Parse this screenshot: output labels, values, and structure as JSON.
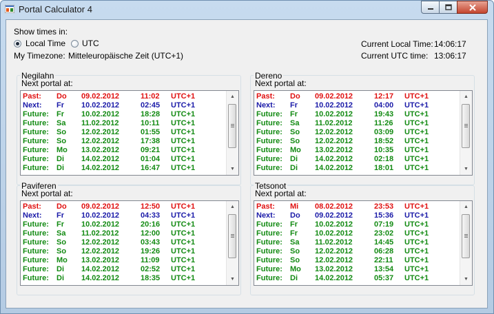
{
  "window": {
    "title": "Portal Calculator 4"
  },
  "settings": {
    "show_times_label": "Show times in:",
    "local_time_label": "Local Time",
    "utc_label": "UTC",
    "selected": "Local Time",
    "my_timezone_label": "My Timezone:",
    "my_timezone_value": "Mitteleuropäische Zeit (UTC+1)"
  },
  "clock": {
    "current_local_label": "Current Local Time:",
    "current_local_value": "14:06:17",
    "current_utc_label": "Current UTC time:",
    "current_utc_value": "13:06:17"
  },
  "colors": {
    "past": "#e01010",
    "next": "#1a1aa8",
    "future": "#128a12"
  },
  "portals": [
    {
      "name": "Negilahn",
      "subtitle": "Next portal at:",
      "rows": [
        {
          "type": "Past:",
          "day": "Do",
          "date": "09.02.2012",
          "time": "11:02",
          "tz": "UTC+1"
        },
        {
          "type": "Next:",
          "day": "Fr",
          "date": "10.02.2012",
          "time": "02:45",
          "tz": "UTC+1"
        },
        {
          "type": "Future:",
          "day": "Fr",
          "date": "10.02.2012",
          "time": "18:28",
          "tz": "UTC+1"
        },
        {
          "type": "Future:",
          "day": "Sa",
          "date": "11.02.2012",
          "time": "10:11",
          "tz": "UTC+1"
        },
        {
          "type": "Future:",
          "day": "So",
          "date": "12.02.2012",
          "time": "01:55",
          "tz": "UTC+1"
        },
        {
          "type": "Future:",
          "day": "So",
          "date": "12.02.2012",
          "time": "17:38",
          "tz": "UTC+1"
        },
        {
          "type": "Future:",
          "day": "Mo",
          "date": "13.02.2012",
          "time": "09:21",
          "tz": "UTC+1"
        },
        {
          "type": "Future:",
          "day": "Di",
          "date": "14.02.2012",
          "time": "01:04",
          "tz": "UTC+1"
        },
        {
          "type": "Future:",
          "day": "Di",
          "date": "14.02.2012",
          "time": "16:47",
          "tz": "UTC+1"
        }
      ]
    },
    {
      "name": "Dereno",
      "subtitle": "Next portal at:",
      "rows": [
        {
          "type": "Past:",
          "day": "Do",
          "date": "09.02.2012",
          "time": "12:17",
          "tz": "UTC+1"
        },
        {
          "type": "Next:",
          "day": "Fr",
          "date": "10.02.2012",
          "time": "04:00",
          "tz": "UTC+1"
        },
        {
          "type": "Future:",
          "day": "Fr",
          "date": "10.02.2012",
          "time": "19:43",
          "tz": "UTC+1"
        },
        {
          "type": "Future:",
          "day": "Sa",
          "date": "11.02.2012",
          "time": "11:26",
          "tz": "UTC+1"
        },
        {
          "type": "Future:",
          "day": "So",
          "date": "12.02.2012",
          "time": "03:09",
          "tz": "UTC+1"
        },
        {
          "type": "Future:",
          "day": "So",
          "date": "12.02.2012",
          "time": "18:52",
          "tz": "UTC+1"
        },
        {
          "type": "Future:",
          "day": "Mo",
          "date": "13.02.2012",
          "time": "10:35",
          "tz": "UTC+1"
        },
        {
          "type": "Future:",
          "day": "Di",
          "date": "14.02.2012",
          "time": "02:18",
          "tz": "UTC+1"
        },
        {
          "type": "Future:",
          "day": "Di",
          "date": "14.02.2012",
          "time": "18:01",
          "tz": "UTC+1"
        }
      ]
    },
    {
      "name": "Paviferen",
      "subtitle": "Next portal at:",
      "rows": [
        {
          "type": "Past:",
          "day": "Do",
          "date": "09.02.2012",
          "time": "12:50",
          "tz": "UTC+1"
        },
        {
          "type": "Next:",
          "day": "Fr",
          "date": "10.02.2012",
          "time": "04:33",
          "tz": "UTC+1"
        },
        {
          "type": "Future:",
          "day": "Fr",
          "date": "10.02.2012",
          "time": "20:16",
          "tz": "UTC+1"
        },
        {
          "type": "Future:",
          "day": "Sa",
          "date": "11.02.2012",
          "time": "12:00",
          "tz": "UTC+1"
        },
        {
          "type": "Future:",
          "day": "So",
          "date": "12.02.2012",
          "time": "03:43",
          "tz": "UTC+1"
        },
        {
          "type": "Future:",
          "day": "So",
          "date": "12.02.2012",
          "time": "19:26",
          "tz": "UTC+1"
        },
        {
          "type": "Future:",
          "day": "Mo",
          "date": "13.02.2012",
          "time": "11:09",
          "tz": "UTC+1"
        },
        {
          "type": "Future:",
          "day": "Di",
          "date": "14.02.2012",
          "time": "02:52",
          "tz": "UTC+1"
        },
        {
          "type": "Future:",
          "day": "Di",
          "date": "14.02.2012",
          "time": "18:35",
          "tz": "UTC+1"
        }
      ]
    },
    {
      "name": "Tetsonot",
      "subtitle": "Next portal at:",
      "rows": [
        {
          "type": "Past:",
          "day": "Mi",
          "date": "08.02.2012",
          "time": "23:53",
          "tz": "UTC+1"
        },
        {
          "type": "Next:",
          "day": "Do",
          "date": "09.02.2012",
          "time": "15:36",
          "tz": "UTC+1"
        },
        {
          "type": "Future:",
          "day": "Fr",
          "date": "10.02.2012",
          "time": "07:19",
          "tz": "UTC+1"
        },
        {
          "type": "Future:",
          "day": "Fr",
          "date": "10.02.2012",
          "time": "23:02",
          "tz": "UTC+1"
        },
        {
          "type": "Future:",
          "day": "Sa",
          "date": "11.02.2012",
          "time": "14:45",
          "tz": "UTC+1"
        },
        {
          "type": "Future:",
          "day": "So",
          "date": "12.02.2012",
          "time": "06:28",
          "tz": "UTC+1"
        },
        {
          "type": "Future:",
          "day": "So",
          "date": "12.02.2012",
          "time": "22:11",
          "tz": "UTC+1"
        },
        {
          "type": "Future:",
          "day": "Mo",
          "date": "13.02.2012",
          "time": "13:54",
          "tz": "UTC+1"
        },
        {
          "type": "Future:",
          "day": "Di",
          "date": "14.02.2012",
          "time": "05:37",
          "tz": "UTC+1"
        }
      ]
    }
  ]
}
